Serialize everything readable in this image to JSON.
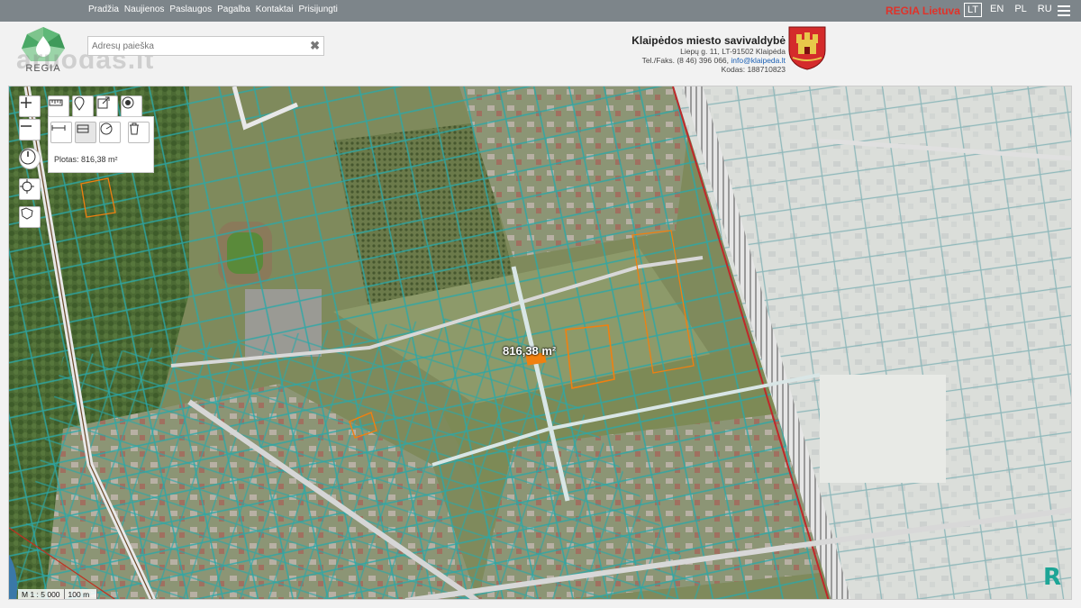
{
  "topnav": {
    "items": [
      "Pradžia",
      "Naujienos",
      "Paslaugos",
      "Pagalba",
      "Kontaktai",
      "Prisijungti"
    ],
    "brand": "REGIA Lietuva",
    "languages": [
      "LT",
      "EN",
      "PL",
      "RU"
    ],
    "active_language": "LT"
  },
  "header": {
    "logo_text": "REGIA",
    "watermark": "aruodas.lt",
    "search_placeholder": "Adresų paieška",
    "municipality": {
      "name": "Klaipėdos miesto savivaldybė",
      "address": "Liepų g. 11, LT-91502 Klaipėda",
      "phone_prefix": "Tel./Faks. (8 46) 396 066,",
      "email": "info@klaipeda.lt",
      "code": "Kodas: 188710823"
    }
  },
  "map": {
    "area_label": "816,38 m²",
    "measure_text": "Plotas: 816,38 m²",
    "scale_ratio": "M 1 : 5 000",
    "scale_bar": "100 m",
    "corner_logo": "R"
  },
  "icons": [
    "zoom-in-icon",
    "zoom-out-icon",
    "ruler-icon",
    "marker-icon",
    "export-icon",
    "target-icon",
    "measure-line-icon",
    "measure-area-icon",
    "measure-radius-icon",
    "trash-icon",
    "compass-icon",
    "locate-icon",
    "region-icon",
    "search-clear-icon"
  ],
  "colors": {
    "topbar": "#7d858a",
    "brand": "#e0322a",
    "parcel": "#2aa8a8",
    "highlight": "#f08010",
    "boundary": "#c0282a"
  }
}
